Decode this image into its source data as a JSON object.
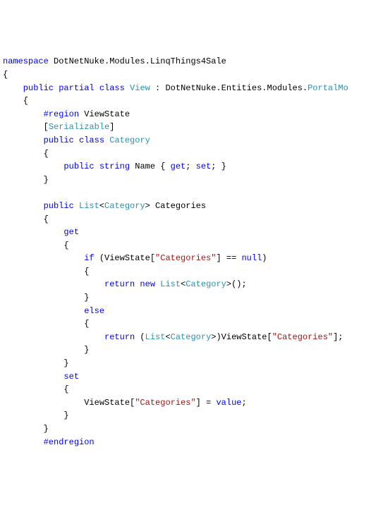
{
  "code": {
    "l1": {
      "a": "namespace",
      "b": " DotNetNuke.Modules.LinqThings4Sale"
    },
    "l2": "{",
    "l3": {
      "a": "    public",
      "b": " partial",
      "c": " class",
      "d": " View",
      "e": " : DotNetNuke.Entities.Modules.",
      "f": "PortalMo"
    },
    "l4": "    {",
    "l5": {
      "a": "        #region",
      "b": " ViewState"
    },
    "l6": {
      "a": "        [",
      "b": "Serializable",
      "c": "]"
    },
    "l7": {
      "a": "        public",
      "b": " class",
      "c": " Category"
    },
    "l8": "        {",
    "l9": {
      "a": "            public",
      "b": " string",
      "c": " Name { ",
      "d": "get",
      "e": "; ",
      "f": "set",
      "g": "; }"
    },
    "l10": "        }",
    "l11": "",
    "l12": {
      "a": "        public",
      "b": " List",
      "c": "<",
      "d": "Category",
      "e": "> Categories"
    },
    "l13": "        {",
    "l14": {
      "a": "            get"
    },
    "l15": "            {",
    "l16": {
      "a": "                if",
      "b": " (ViewState[",
      "c": "\"Categories\"",
      "d": "] == ",
      "e": "null",
      "f": ")"
    },
    "l17": "                {",
    "l18": {
      "a": "                    return",
      "b": " new",
      "c": " List",
      "d": "<",
      "e": "Category",
      "f": ">();"
    },
    "l19": "                }",
    "l20": {
      "a": "                else"
    },
    "l21": "                {",
    "l22": {
      "a": "                    return",
      "b": " (",
      "c": "List",
      "d": "<",
      "e": "Category",
      "f": ">)ViewState[",
      "g": "\"Categories\"",
      "h": "];"
    },
    "l23": "                }",
    "l24": "            }",
    "l25": {
      "a": "            set"
    },
    "l26": "            {",
    "l27": {
      "a": "                ViewState[",
      "b": "\"Categories\"",
      "c": "] = ",
      "d": "value",
      "e": ";"
    },
    "l28": "            }",
    "l29": "        }",
    "l30": {
      "a": "        #endregion"
    }
  }
}
